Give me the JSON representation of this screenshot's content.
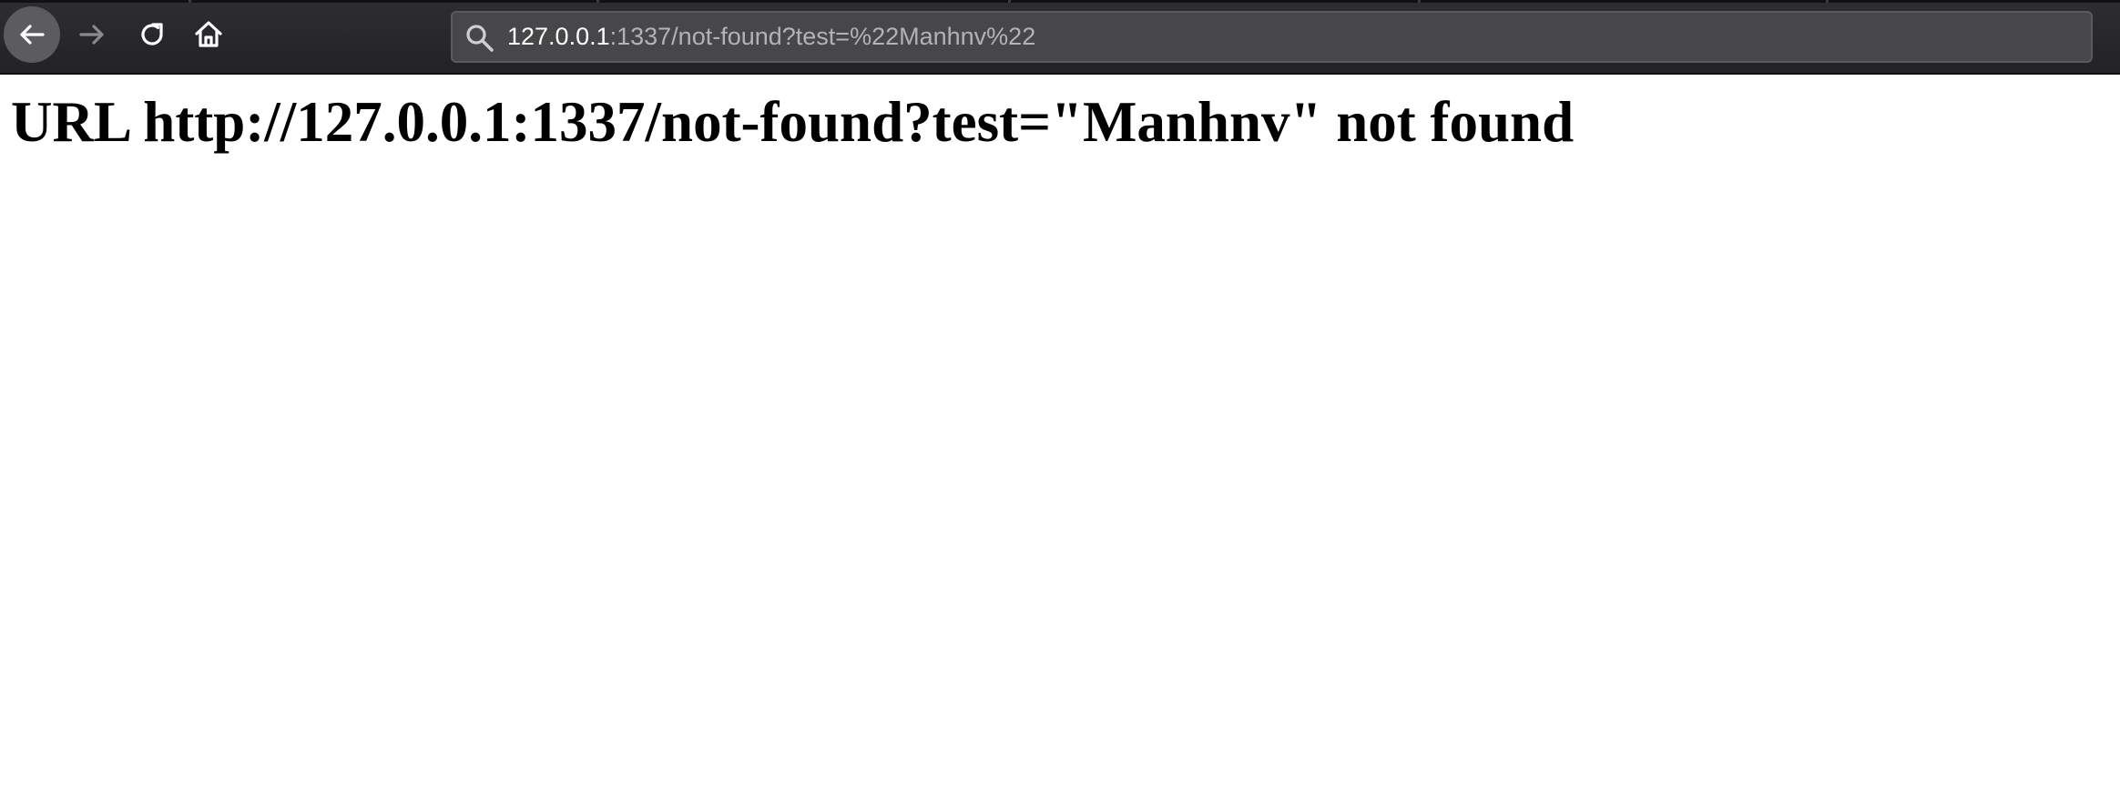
{
  "browser": {
    "toolbar": {
      "back_icon": "arrow-left-icon",
      "forward_icon": "arrow-right-icon",
      "reload_icon": "reload-icon",
      "home_icon": "home-icon"
    },
    "address_bar": {
      "search_icon": "search-icon",
      "url_host": "127.0.0.1",
      "url_rest": ":1337/not-found?test=%22Manhnv%22"
    },
    "colors": {
      "toolbar_bg": "#2e2e32",
      "address_bar_bg": "#474749",
      "url_host_color": "#ffffff",
      "url_rest_color": "#b3b3b5"
    }
  },
  "page": {
    "heading": "URL http://127.0.0.1:1337/not-found?test=\"Manhnv\" not found"
  }
}
